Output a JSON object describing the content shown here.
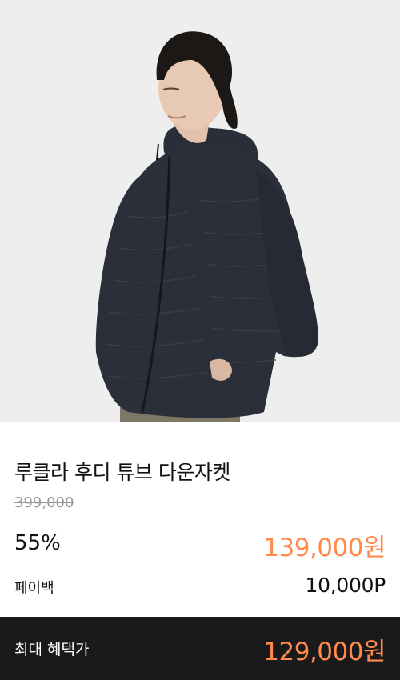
{
  "product": {
    "image_alt": "model wearing navy hooded down jacket",
    "title": "루클라 후디 튜브 다운자켓",
    "original_price": "399,000",
    "discount_rate": "55%",
    "sale_price": "139,000원"
  },
  "payback": {
    "label": "페이백",
    "value": "10,000P"
  },
  "max_benefit": {
    "label": "최대 혜택가",
    "price": "129,000원"
  },
  "colors": {
    "accent": "#ff8a4c",
    "bar_bg": "#1a1a1a",
    "image_bg": "#eeeeee",
    "jacket": "#2b2f3a"
  }
}
